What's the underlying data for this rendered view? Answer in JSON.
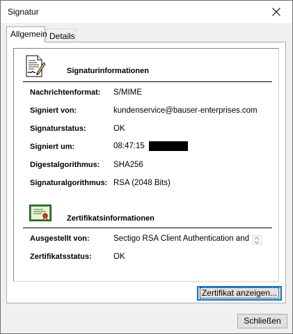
{
  "window": {
    "title": "Signatur"
  },
  "tabs": [
    {
      "label": "Allgemein",
      "active": true
    },
    {
      "label": "Details",
      "active": false
    }
  ],
  "signature_section": {
    "heading": "Signaturinformationen",
    "icon": "signed-document-icon",
    "rows": [
      {
        "label": "Nachrichtenformat:",
        "value": "S/MIME"
      },
      {
        "label": "Signiert von:",
        "value": "kundenservice@bauser-enterprises.com"
      },
      {
        "label": "Signaturstatus:",
        "value": "OK"
      },
      {
        "label": "Signiert um:",
        "value": "08:47:15",
        "redacted": true
      },
      {
        "label": "Digestalgorithmus:",
        "value": "SHA256"
      },
      {
        "label": "Signaturalgorithmus:",
        "value": "RSA (2048 Bits)"
      }
    ]
  },
  "certificate_section": {
    "heading": "Zertifikatsinformationen",
    "icon": "certificate-icon",
    "rows": [
      {
        "label": "Ausgestellt von:",
        "value": "Sectigo RSA Client Authentication and"
      },
      {
        "label": "Zertifikatsstatus:",
        "value": "OK"
      }
    ]
  },
  "buttons": {
    "view_certificate": "Zertifikat anzeigen...",
    "close": "Schließen"
  },
  "colors": {
    "focus_border": "#0078d7",
    "button_bg": "#e1e1e1",
    "redaction": "#000000"
  }
}
